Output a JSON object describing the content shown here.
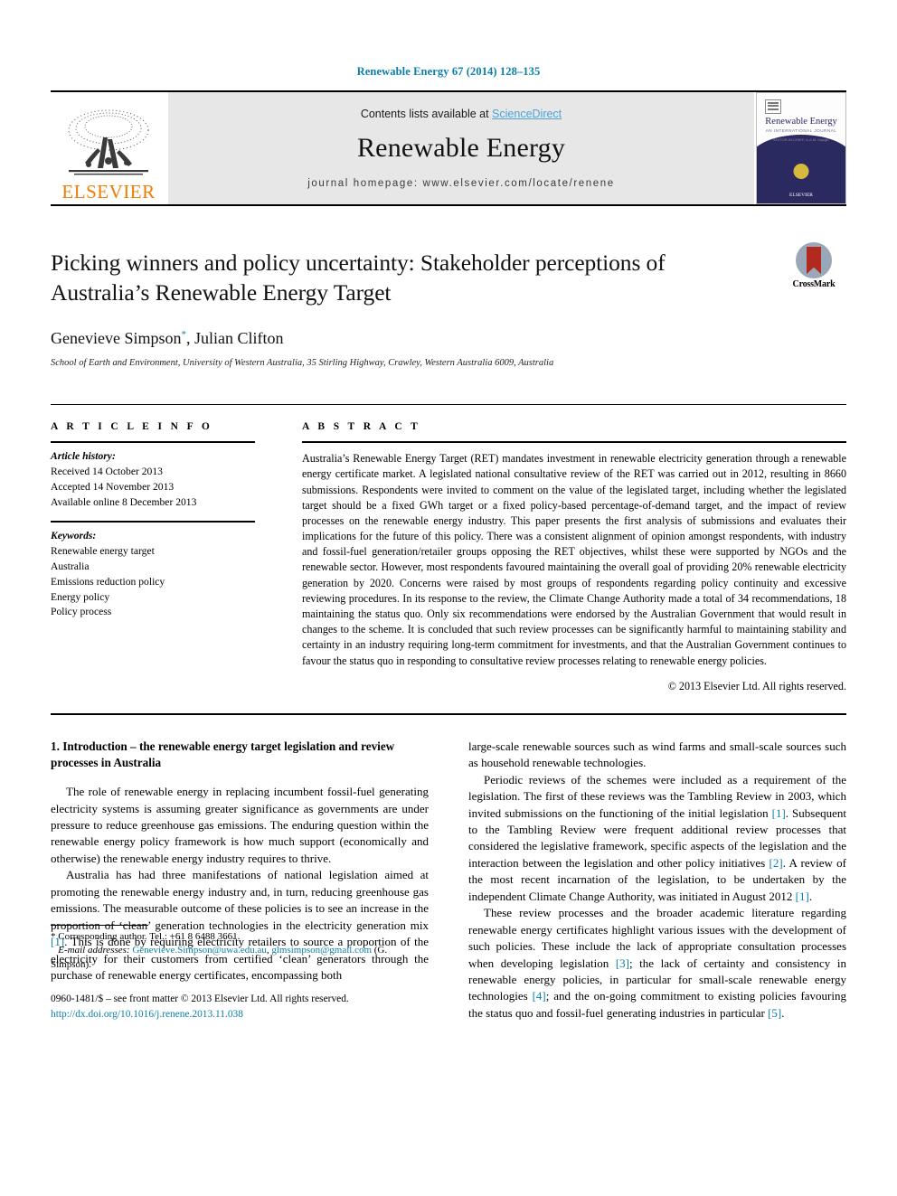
{
  "running_head": "Renewable Energy 67 (2014) 128–135",
  "header": {
    "contents_prefix": "Contents lists available at ",
    "sciencedirect": "ScienceDirect",
    "journal_title": "Renewable Energy",
    "homepage": "journal homepage: www.elsevier.com/locate/renene",
    "publisher_logo_text": "ELSEVIER",
    "cover": {
      "title": "Renewable Energy",
      "subtitle": "AN INTERNATIONAL JOURNAL",
      "subtitle2": "EDITOR-IN-CHIEF: A.A.M. Sayigh",
      "publisher": "ELSEVIER"
    }
  },
  "article": {
    "title": "Picking winners and policy uncertainty: Stakeholder perceptions of Australia’s Renewable Energy Target",
    "authors": "Genevieve Simpson, Julian Clifton",
    "author_marker": "*",
    "affiliation": "School of Earth and Environment, University of Western Australia, 35 Stirling Highway, Crawley, Western Australia 6009, Australia",
    "crossmark_label": "CrossMark"
  },
  "info": {
    "heading": "A R T I C L E   I N F O",
    "history_label": "Article history:",
    "history": [
      "Received 14 October 2013",
      "Accepted 14 November 2013",
      "Available online 8 December 2013"
    ],
    "keywords_label": "Keywords:",
    "keywords": [
      "Renewable energy target",
      "Australia",
      "Emissions reduction policy",
      "Energy policy",
      "Policy process"
    ]
  },
  "abstract": {
    "heading": "A B S T R A C T",
    "text": "Australia’s Renewable Energy Target (RET) mandates investment in renewable electricity generation through a renewable energy certificate market. A legislated national consultative review of the RET was carried out in 2012, resulting in 8660 submissions. Respondents were invited to comment on the value of the legislated target, including whether the legislated target should be a fixed GWh target or a fixed policy-based percentage-of-demand target, and the impact of review processes on the renewable energy industry. This paper presents the first analysis of submissions and evaluates their implications for the future of this policy. There was a consistent alignment of opinion amongst respondents, with industry and fossil-fuel generation/retailer groups opposing the RET objectives, whilst these were supported by NGOs and the renewable sector. However, most respondents favoured maintaining the overall goal of providing 20% renewable electricity generation by 2020. Concerns were raised by most groups of respondents regarding policy continuity and excessive reviewing procedures. In its response to the review, the Climate Change Authority made a total of 34 recommendations, 18 maintaining the status quo. Only six recommendations were endorsed by the Australian Government that would result in changes to the scheme. It is concluded that such review processes can be significantly harmful to maintaining stability and certainty in an industry requiring long-term commitment for investments, and that the Australian Government continues to favour the status quo in responding to consultative review processes relating to renewable energy policies.",
    "copyright": "© 2013 Elsevier Ltd. All rights reserved."
  },
  "body": {
    "section_heading": "1. Introduction – the renewable energy target legislation and review processes in Australia",
    "left_paragraphs": [
      "The role of renewable energy in replacing incumbent fossil-fuel generating electricity systems is assuming greater significance as governments are under pressure to reduce greenhouse gas emissions. The enduring question within the renewable energy policy framework is how much support (economically and otherwise) the renewable energy industry requires to thrive.",
      "Australia has had three manifestations of national legislation aimed at promoting the renewable energy industry and, in turn, reducing greenhouse gas emissions. The measurable outcome of these policies is to see an increase in the proportion of ‘clean’ generation technologies in the electricity generation mix [1]. This is done by requiring electricity retailers to source a proportion of the electricity for their customers from certified ‘clean’ generators through the purchase of renewable energy certificates, encompassing both"
    ],
    "right_paragraphs": [
      "large-scale renewable sources such as wind farms and small-scale sources such as household renewable technologies.",
      "Periodic reviews of the schemes were included as a requirement of the legislation. The first of these reviews was the Tambling Review in 2003, which invited submissions on the functioning of the initial legislation [1]. Subsequent to the Tambling Review were frequent additional review processes that considered the legislative framework, specific aspects of the legislation and the interaction between the legislation and other policy initiatives [2]. A review of the most recent incarnation of the legislation, to be undertaken by the independent Climate Change Authority, was initiated in August 2012 [1].",
      "These review processes and the broader academic literature regarding renewable energy certificates highlight various issues with the development of such policies. These include the lack of appropriate consultation processes when developing legislation [3]; the lack of certainty and consistency in renewable energy policies, in particular for small-scale renewable energy technologies [4]; and the on-going commitment to existing policies favouring the status quo and fossil-fuel generating industries in particular [5]."
    ]
  },
  "footnotes": {
    "corresponding": "* Corresponding author. Tel.: +61 8 6488 3661.",
    "email_label": "E-mail addresses:",
    "email1": "Genevieve.Simpson@uwa.edu.au",
    "email2": "glmsimpson@gmail.com",
    "email_tail": "(G. Simpson).",
    "imprint": "0960-1481/$ – see front matter © 2013 Elsevier Ltd. All rights reserved.",
    "doi": "http://dx.doi.org/10.1016/j.renene.2013.11.038"
  },
  "colors": {
    "link": "#0b7fab",
    "sciencedirect": "#4ca3d6",
    "elsevier_orange": "#ef7d00",
    "band_grey": "#e7e7e7"
  }
}
